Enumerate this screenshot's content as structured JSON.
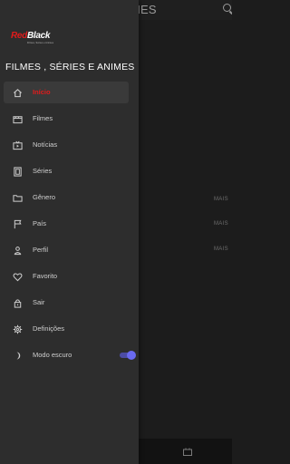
{
  "background_app": {
    "title": "MES",
    "more_labels": [
      "MAIS",
      "MAIS",
      "MAIS"
    ]
  },
  "drawer": {
    "logo": {
      "part1": "Red",
      "part2": "Black",
      "tagline": "Filmes, Séries e Animes"
    },
    "title": "FILMES , SÉRIES E ANIMES",
    "items": [
      {
        "label": "Início",
        "icon": "home-icon",
        "active": true
      },
      {
        "label": "Filmes",
        "icon": "movie-clapper-icon",
        "active": false
      },
      {
        "label": "Notícias",
        "icon": "news-tv-icon",
        "active": false
      },
      {
        "label": "Séries",
        "icon": "series-icon",
        "active": false
      },
      {
        "label": "Gênero",
        "icon": "folder-icon",
        "active": false
      },
      {
        "label": "País",
        "icon": "flag-icon",
        "active": false
      },
      {
        "label": "Perfil",
        "icon": "person-icon",
        "active": false
      },
      {
        "label": "Favorito",
        "icon": "heart-icon",
        "active": false
      },
      {
        "label": "Sair",
        "icon": "lock-icon",
        "active": false
      },
      {
        "label": "Definições",
        "icon": "gear-icon",
        "active": false
      }
    ],
    "dark_mode": {
      "label": "Modo escuro",
      "icon": "moon-icon",
      "enabled": true
    }
  },
  "colors": {
    "accent_red": "#e01b1b",
    "switch_blue": "#6a6af0",
    "drawer_bg": "#2d2d2d"
  }
}
